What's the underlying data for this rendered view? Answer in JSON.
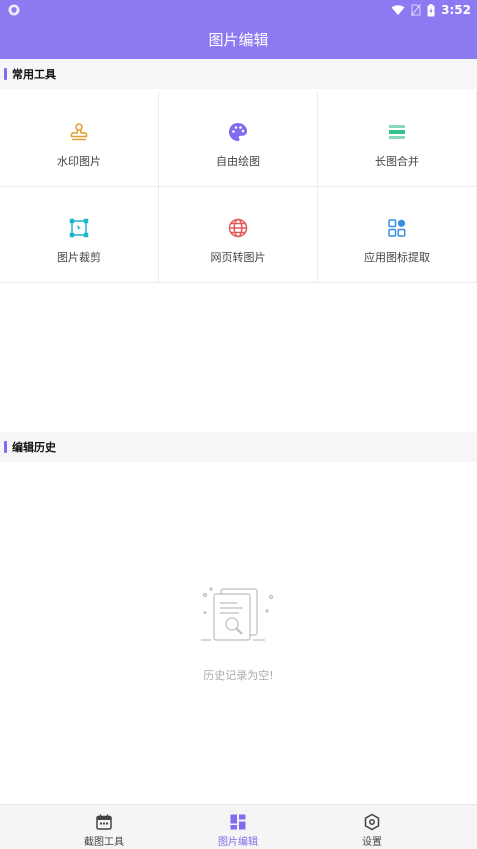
{
  "status_bar": {
    "time": "3:52"
  },
  "title_bar": {
    "title": "图片编辑"
  },
  "tools_section": {
    "title": "常用工具",
    "items": [
      {
        "label": "水印图片",
        "icon": "stamp-icon",
        "color": "#e0a030"
      },
      {
        "label": "自由绘图",
        "icon": "palette-icon",
        "color": "#7f6cf0"
      },
      {
        "label": "长图合并",
        "icon": "stack-icon",
        "color": "#35c08a"
      },
      {
        "label": "图片裁剪",
        "icon": "crop-icon",
        "color": "#1fb5c9"
      },
      {
        "label": "网页转图片",
        "icon": "globe-icon",
        "color": "#e05a5a"
      },
      {
        "label": "应用图标提取",
        "icon": "apps-icon",
        "color": "#3a8fe0"
      }
    ]
  },
  "history_section": {
    "title": "编辑历史",
    "empty_text": "历史记录为空!"
  },
  "bottom_nav": {
    "items": [
      {
        "label": "截图工具",
        "icon": "calendar-icon"
      },
      {
        "label": "图片编辑",
        "icon": "dashboard-icon"
      },
      {
        "label": "设置",
        "icon": "hexagon-settings-icon"
      }
    ],
    "active_color": "#7f6cf0"
  },
  "theme": {
    "primary": "#8b7af2"
  }
}
